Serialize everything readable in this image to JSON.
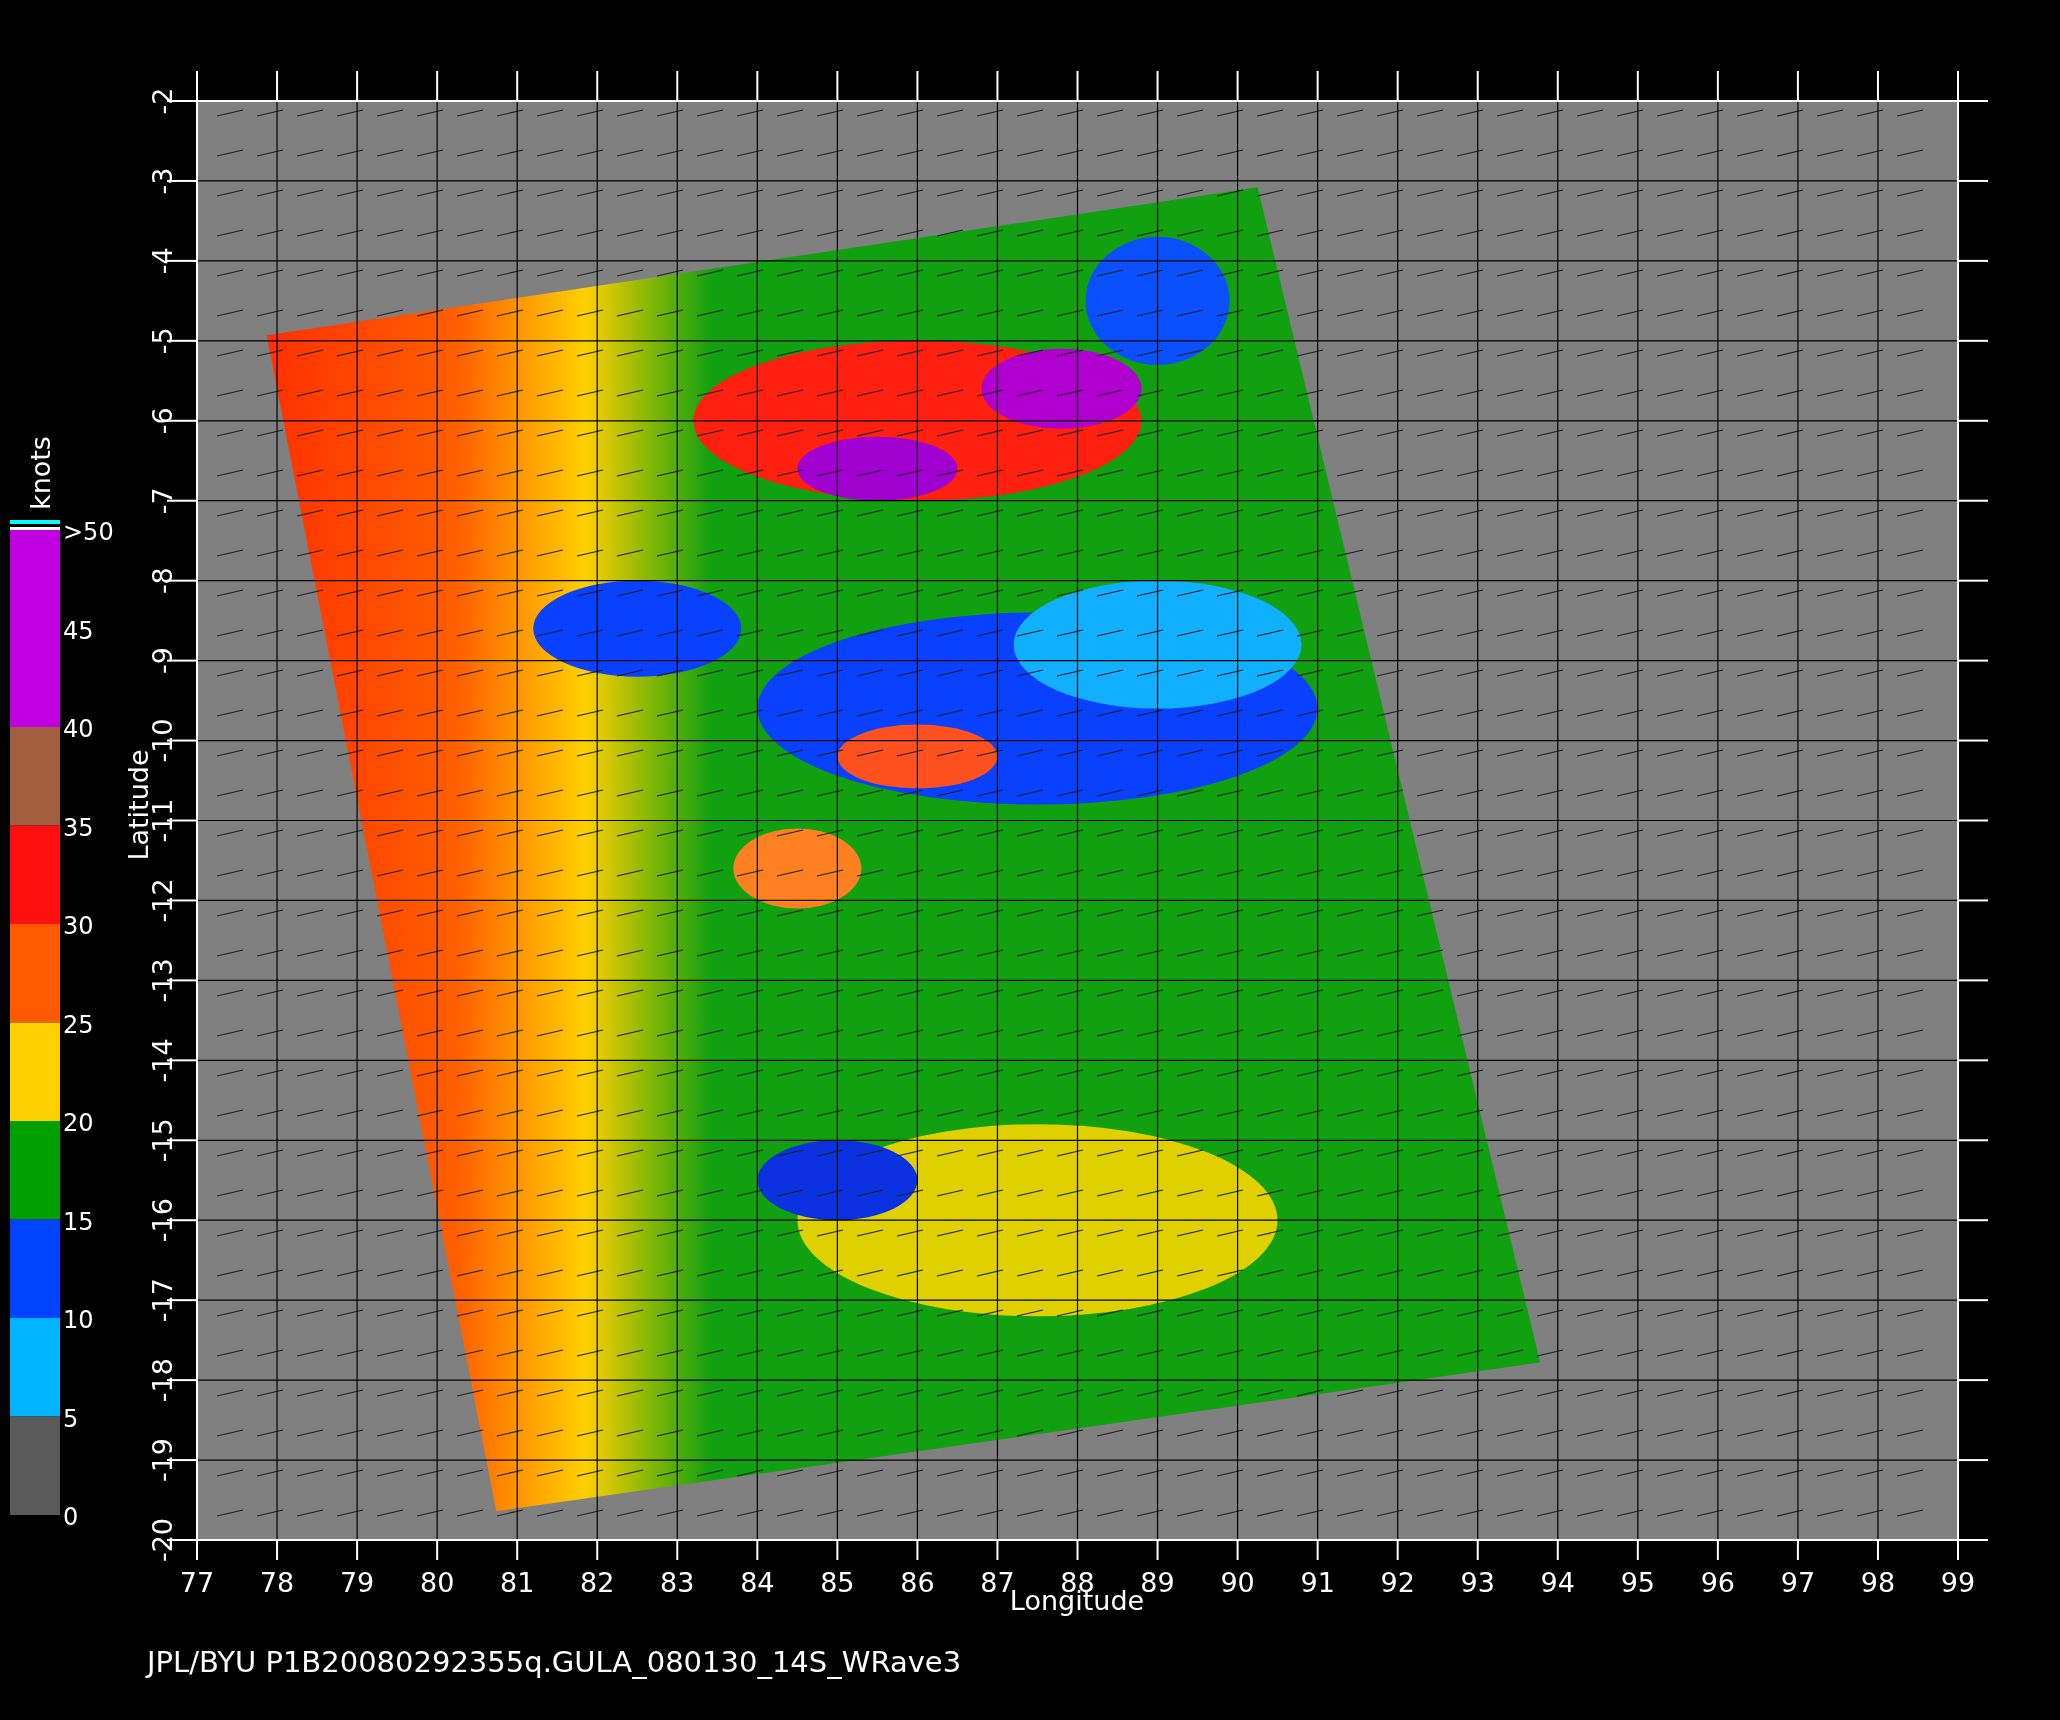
{
  "plot": {
    "x_axis": {
      "label": "Longitude",
      "ticks": [
        "77",
        "78",
        "79",
        "80",
        "81",
        "82",
        "83",
        "84",
        "85",
        "86",
        "87",
        "88",
        "89",
        "90",
        "91",
        "92",
        "93",
        "94",
        "95",
        "96",
        "97",
        "98",
        "99"
      ]
    },
    "y_axis": {
      "label": "Latitude",
      "ticks": [
        "-2",
        "-3",
        "-4",
        "-5",
        "-6",
        "-7",
        "-8",
        "-9",
        "-10",
        "-11",
        "-12",
        "-13",
        "-14",
        "-15",
        "-16",
        "-17",
        "-18",
        "-19",
        "-20"
      ]
    }
  },
  "colorbar": {
    "title": "knots",
    "labels": [
      ">50",
      "45",
      "40",
      "35",
      "30",
      "25",
      "20",
      "15",
      "10",
      "5",
      "0"
    ],
    "bands": [
      {
        "color": "#c000e0"
      },
      {
        "color": "#a06040"
      },
      {
        "color": "#ff1010"
      },
      {
        "color": "#ff5a00"
      },
      {
        "color": "#ffd000"
      },
      {
        "color": "#00a000"
      },
      {
        "color": "#0044ff"
      },
      {
        "color": "#00b4ff"
      },
      {
        "color": "#5a5a5a"
      }
    ]
  },
  "footer": "JPL/BYU  P1B20080292355q.GULA_080130_14S_WRave3"
}
